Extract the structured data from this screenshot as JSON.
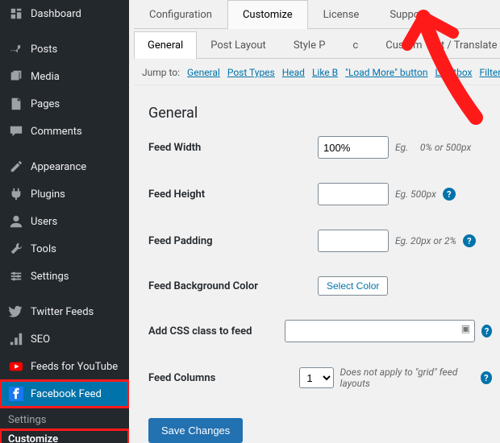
{
  "sidebar": {
    "items": [
      {
        "label": "Dashboard",
        "icon": "dashboard"
      },
      {
        "label": "Posts",
        "icon": "pin"
      },
      {
        "label": "Media",
        "icon": "media"
      },
      {
        "label": "Pages",
        "icon": "pages"
      },
      {
        "label": "Comments",
        "icon": "comments"
      },
      {
        "label": "Appearance",
        "icon": "appearance"
      },
      {
        "label": "Plugins",
        "icon": "plugins"
      },
      {
        "label": "Users",
        "icon": "users"
      },
      {
        "label": "Tools",
        "icon": "tools"
      },
      {
        "label": "Settings",
        "icon": "settings"
      },
      {
        "label": "Twitter Feeds",
        "icon": "twitter"
      },
      {
        "label": "SEO",
        "icon": "seo"
      },
      {
        "label": "Feeds for YouTube",
        "icon": "youtube"
      },
      {
        "label": "Facebook Feed",
        "icon": "facebook"
      }
    ],
    "sub_head": "Settings",
    "sub_current": "Customize"
  },
  "top_tabs": [
    "Configuration",
    "Customize",
    "License",
    "Support"
  ],
  "top_active": "Customize",
  "sub_tabs": [
    "General",
    "Post Layout",
    "Style P",
    "c",
    "Custom Text / Translate"
  ],
  "sub_active": "General",
  "jump": {
    "label": "Jump to:",
    "links": [
      "General",
      "Post Types",
      "Head",
      "Like B",
      "\"Load More\" button",
      "Lightbox",
      "Filter"
    ]
  },
  "section_title": "General",
  "fields": {
    "width": {
      "label": "Feed Width",
      "value": "100%",
      "hint_prefix": "Eg.",
      "hint_suffix": "0% or 500px"
    },
    "height": {
      "label": "Feed Height",
      "value": "",
      "hint": "Eg. 500px"
    },
    "padding": {
      "label": "Feed Padding",
      "value": "",
      "hint": "Eg. 20px or 2%"
    },
    "bg": {
      "label": "Feed Background Color",
      "button": "Select Color"
    },
    "css": {
      "label": "Add CSS class to feed",
      "value": ""
    },
    "cols": {
      "label": "Feed Columns",
      "value": "1",
      "hint": "Does not apply to \"grid\" feed layouts"
    }
  },
  "save_label": "Save Changes"
}
